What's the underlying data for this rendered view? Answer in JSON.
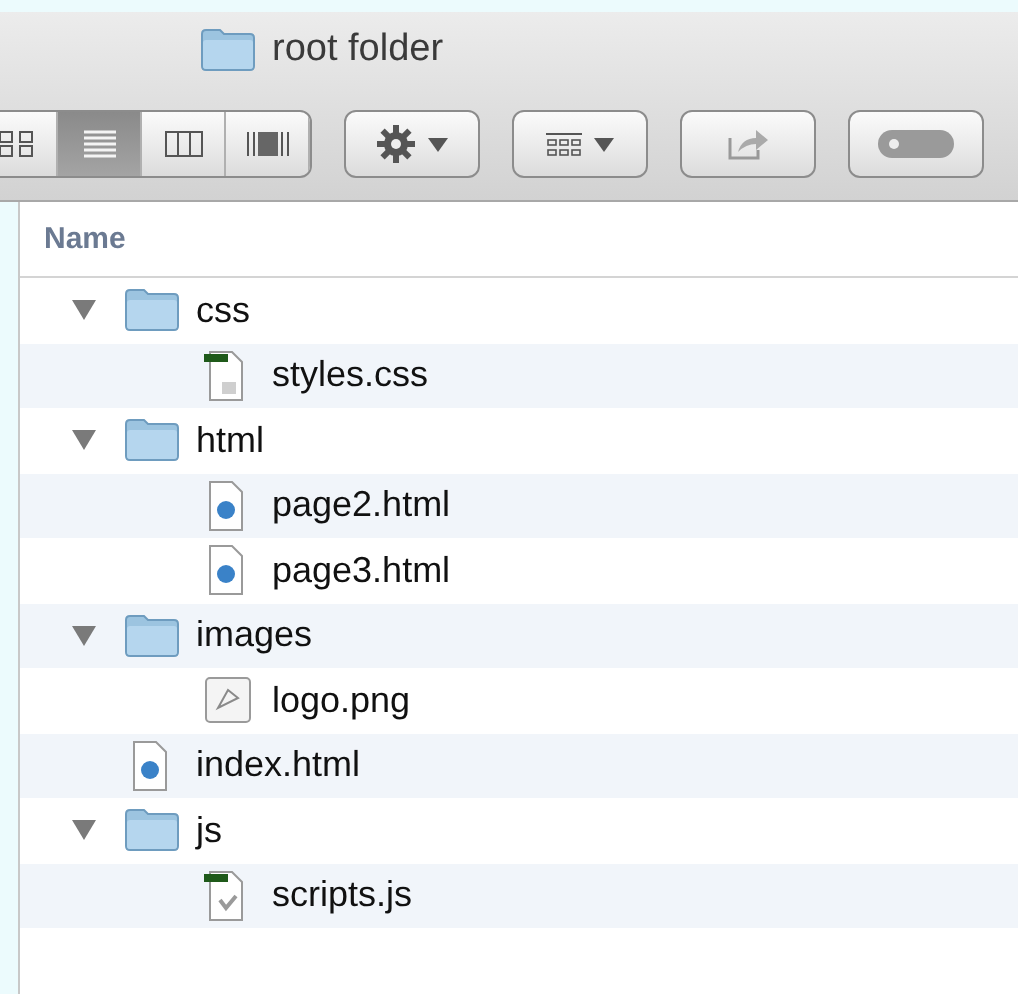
{
  "window": {
    "title": "root folder"
  },
  "toolbar": {
    "view_modes": [
      {
        "kind": "icon",
        "selected": false
      },
      {
        "kind": "list",
        "selected": true
      },
      {
        "kind": "columns",
        "selected": false
      },
      {
        "kind": "coverflow",
        "selected": false
      }
    ]
  },
  "list": {
    "header": "Name",
    "tree": [
      {
        "name": "css",
        "kind": "folder",
        "expanded": true,
        "children": [
          {
            "name": "styles.css",
            "kind": "stylesheet"
          }
        ]
      },
      {
        "name": "html",
        "kind": "folder",
        "expanded": true,
        "children": [
          {
            "name": "page2.html",
            "kind": "html"
          },
          {
            "name": "page3.html",
            "kind": "html"
          }
        ]
      },
      {
        "name": "images",
        "kind": "folder",
        "expanded": true,
        "children": [
          {
            "name": "logo.png",
            "kind": "image"
          }
        ]
      },
      {
        "name": "index.html",
        "kind": "html"
      },
      {
        "name": "js",
        "kind": "folder",
        "expanded": true,
        "children": [
          {
            "name": "scripts.js",
            "kind": "script"
          }
        ]
      }
    ]
  }
}
